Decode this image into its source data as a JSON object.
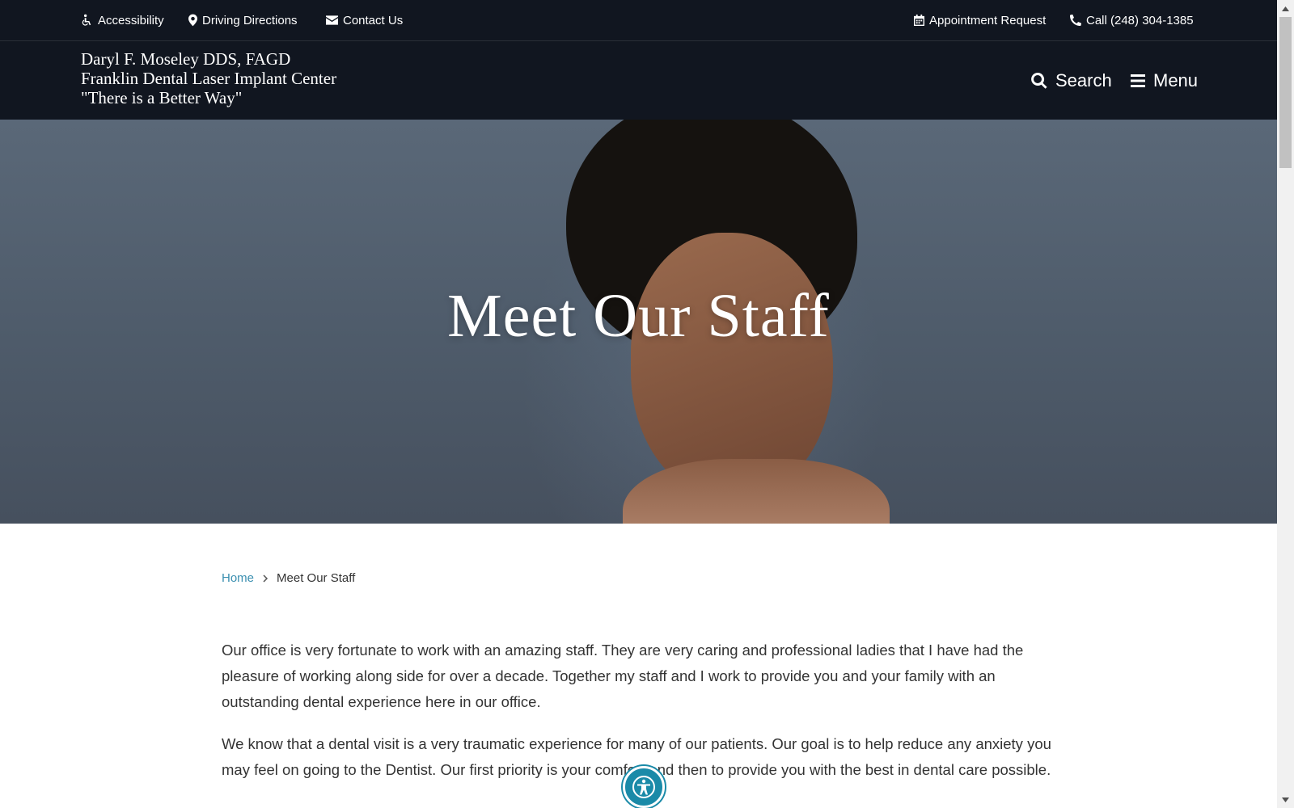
{
  "utility_bar": {
    "accessibility": "Accessibility",
    "driving_directions": "Driving Directions",
    "contact_us": "Contact Us",
    "appointment_request": "Appointment Request",
    "call": "Call (248) 304-1385"
  },
  "header": {
    "brand_line1": "Daryl F. Moseley DDS, FAGD",
    "brand_line2": "Franklin Dental Laser Implant Center",
    "brand_line3": "\"There is a Better Way\"",
    "search_label": "Search",
    "menu_label": "Menu"
  },
  "hero": {
    "title": "Meet Our Staff"
  },
  "breadcrumb": {
    "home": "Home",
    "current": "Meet Our Staff"
  },
  "content": {
    "paragraph1": "Our office is very fortunate to work with an amazing staff.  They are very caring and professional ladies that I have had the pleasure of working along side for over a decade.  Together my staff and I work to provide you and your family with an outstanding dental experience here in our office.",
    "paragraph2": "We know that a dental visit is a very traumatic experience for many of our patients.  Our goal is to help reduce any anxiety you may feel on going to the Dentist.  Our first priority is your comfort and then to provide you with the best in dental care possible."
  },
  "icons": {
    "accessibility": "wheelchair-icon",
    "directions": "map-marker-icon",
    "contact": "envelope-icon",
    "appointment": "calendar-icon",
    "call": "phone-icon",
    "search": "search-icon",
    "menu": "hamburger-icon",
    "widget": "accessibility-person-icon"
  },
  "colors": {
    "header_bg": "#111620",
    "link": "#3a8fb0",
    "widget": "#1a8aa8",
    "text": "#333333"
  }
}
